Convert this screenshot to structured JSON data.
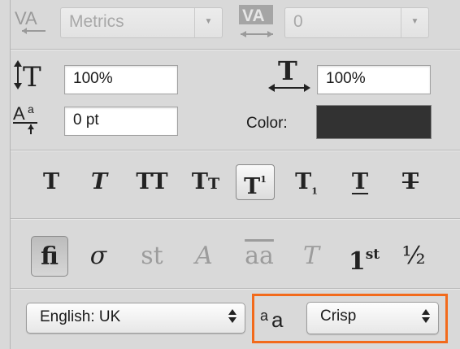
{
  "kerning": {
    "icon": "kerning-icon",
    "value": "Metrics"
  },
  "tracking": {
    "icon": "tracking-icon",
    "value": "0"
  },
  "vertical_scale": {
    "icon": "vertical-scale-icon",
    "value": "100%"
  },
  "horizontal_scale": {
    "icon": "horizontal-scale-icon",
    "value": "100%"
  },
  "baseline_shift": {
    "icon": "baseline-shift-icon",
    "value": "0 pt"
  },
  "color": {
    "label": "Color:",
    "value": "#323232"
  },
  "style_buttons": [
    {
      "name": "faux-bold",
      "glyph": "T"
    },
    {
      "name": "faux-italic",
      "glyph": "T"
    },
    {
      "name": "all-caps",
      "glyph": "TT"
    },
    {
      "name": "small-caps",
      "glyph": "Tt"
    },
    {
      "name": "superscript",
      "glyph": "T",
      "sup": "1",
      "active": true
    },
    {
      "name": "subscript",
      "glyph": "T",
      "sub": "1"
    },
    {
      "name": "underline",
      "glyph": "T"
    },
    {
      "name": "strikethrough",
      "glyph": "T"
    }
  ],
  "opentype_buttons": [
    {
      "name": "standard-ligatures",
      "glyph": "fi",
      "active": true
    },
    {
      "name": "contextual-alternates",
      "glyph": "σ"
    },
    {
      "name": "discretionary-ligatures",
      "glyph": "st",
      "disabled": true
    },
    {
      "name": "swash",
      "glyph": "A",
      "disabled": true
    },
    {
      "name": "stylistic-alternates",
      "glyph": "aa",
      "disabled": true
    },
    {
      "name": "titling-alternates",
      "glyph": "T",
      "disabled": true
    },
    {
      "name": "ordinals",
      "glyph": "1",
      "sup": "st"
    },
    {
      "name": "fractions",
      "glyph": "½"
    }
  ],
  "language": {
    "value": "English: UK"
  },
  "antialias": {
    "icon": "antialias-icon",
    "glyph": "aa",
    "value": "Crisp"
  },
  "colors": {
    "highlight": "#f26a1b",
    "panel": "#d9d9d9"
  }
}
